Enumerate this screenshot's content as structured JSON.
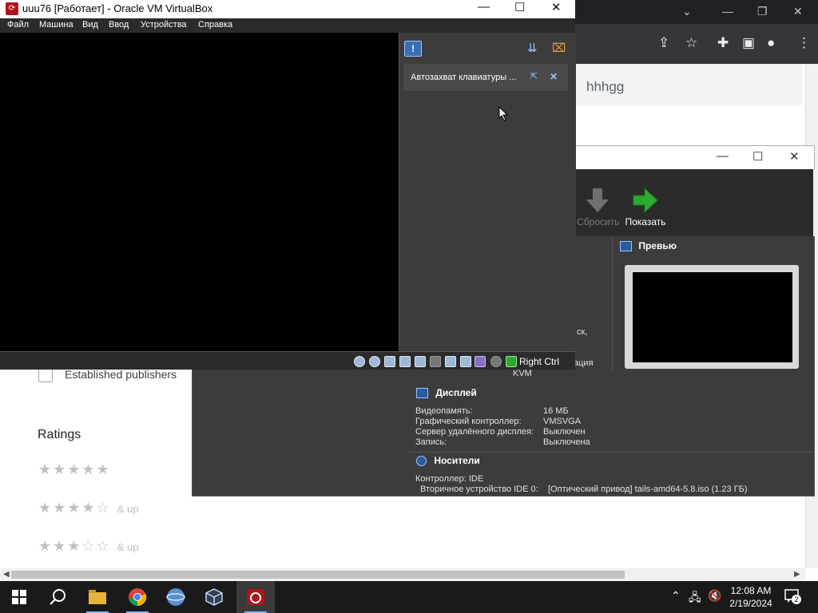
{
  "vm_window": {
    "title": "uuu76 [Работает] - Oracle VM VirtualBox",
    "menu": [
      "Файл",
      "Машина",
      "Вид",
      "Ввод",
      "Устройства",
      "Справка"
    ],
    "notification": "Автозахват клавиатуры ...",
    "host_key": "Right Ctrl"
  },
  "web_page": {
    "url_fragment": "hhhgg",
    "filter_label": "Established publishers",
    "ratings_heading": "Ratings",
    "stars": [
      "★★★★★",
      "★★★★☆",
      "★★★☆☆"
    ],
    "and_up": "& up"
  },
  "vbox_manager": {
    "toolbar": {
      "reset": "Сбросить",
      "show": "Показать"
    },
    "preview_title": "Превью",
    "partial_text_1": "ск,",
    "partial_text_2": "ация",
    "partial_kvm": "KVM",
    "display": {
      "title": "Дисплей",
      "rows": [
        {
          "label": "Видеопамять:",
          "value": "16 МБ"
        },
        {
          "label": "Графический контроллер:",
          "value": "VMSVGA"
        },
        {
          "label": "Сервер удалённого дисплея:",
          "value": "Выключен"
        },
        {
          "label": "Запись:",
          "value": "Выключена"
        }
      ]
    },
    "storage": {
      "title": "Носители",
      "controller": "Контроллер: IDE",
      "device_label": "Вторичное устройство IDE 0:",
      "device_value": "[Оптический привод] tails-amd64-5.8.iso (1.23 ГБ)"
    }
  },
  "taskbar": {
    "time": "12:08 AM",
    "date": "2/19/2024",
    "notification_count": "2"
  },
  "colors": {
    "accent_green": "#2eaa2e",
    "taskbar": "#1a1a1a",
    "vbox_dark": "#3c3c3c"
  }
}
